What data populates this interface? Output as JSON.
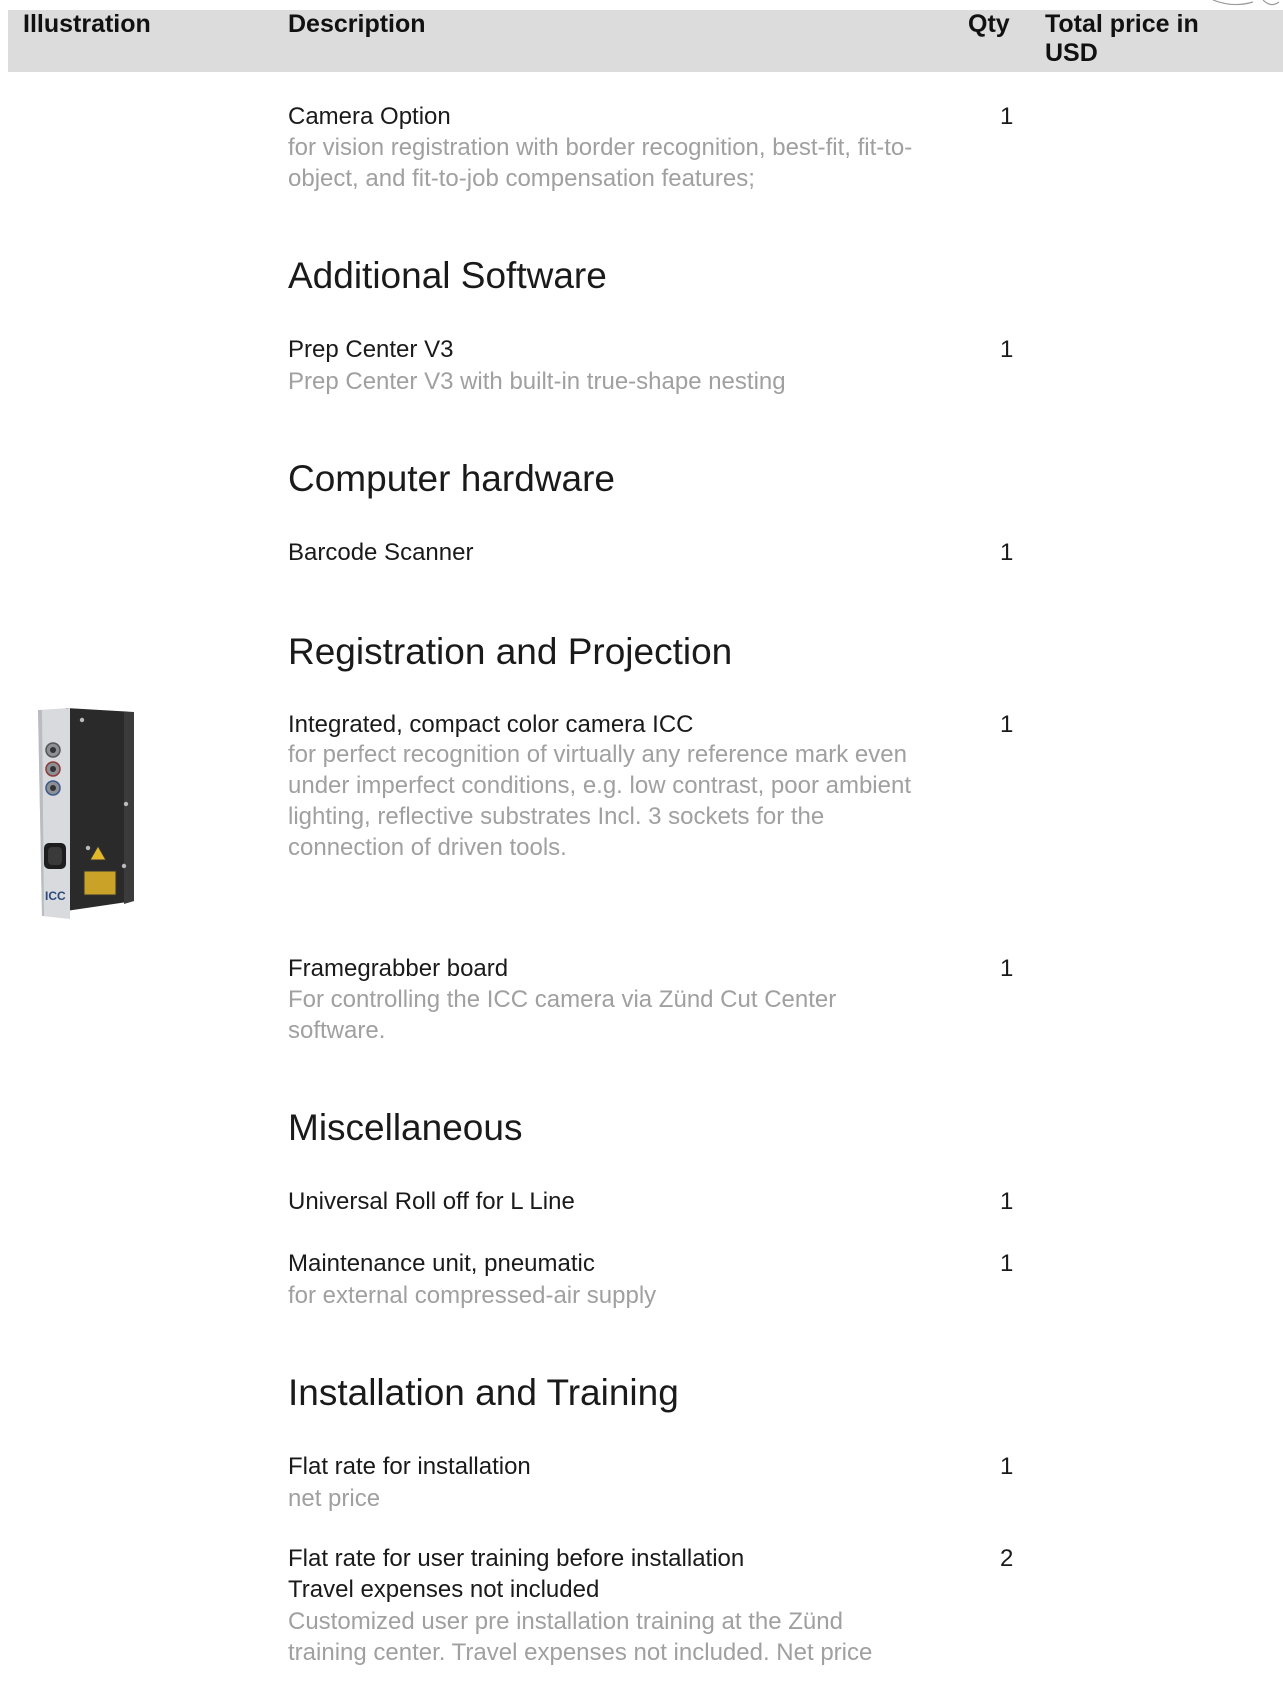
{
  "header": {
    "illustration": "Illustration",
    "description": "Description",
    "qty": "Qty",
    "total_price": "Total price in USD"
  },
  "items": {
    "camera_option": {
      "title": "Camera Option",
      "desc": "for vision registration with border recognition, best-fit, fit-to-object, and fit-to-job compensation features;",
      "qty": "1"
    },
    "prep_center": {
      "title": "Prep Center V3",
      "desc": "Prep Center V3 with built-in true-shape nesting",
      "qty": "1"
    },
    "barcode": {
      "title": "Barcode Scanner",
      "qty": "1"
    },
    "icc": {
      "title": "Integrated, compact color camera ICC",
      "desc": "for perfect recognition of virtually any reference mark even under imperfect conditions, e.g. low contrast, poor ambient lighting, reflective substrates Incl. 3 sockets for the connection of driven tools.",
      "qty": "1"
    },
    "framegrabber": {
      "title": "Framegrabber board",
      "desc": "For controlling the ICC camera via Zünd Cut Center software.",
      "qty": "1"
    },
    "roll_off": {
      "title": "Universal Roll off for L Line",
      "qty": "1"
    },
    "maintenance": {
      "title": "Maintenance unit, pneumatic",
      "desc": "for external compressed-air supply",
      "qty": "1"
    },
    "installation": {
      "title": "Flat rate for installation",
      "desc": "net price",
      "qty": "1"
    },
    "training": {
      "title": "Flat rate for user training before installation",
      "subtitle": "Travel expenses not included",
      "desc": "Customized user pre installation training at the Zünd training center. Travel expenses not included. Net price",
      "qty": "2"
    }
  },
  "sections": {
    "additional_software": "Additional Software",
    "computer_hardware": "Computer hardware",
    "registration": "Registration and Projection",
    "miscellaneous": "Miscellaneous",
    "installation_training": "Installation and Training"
  },
  "illustration": {
    "camera_label": "ICC"
  }
}
